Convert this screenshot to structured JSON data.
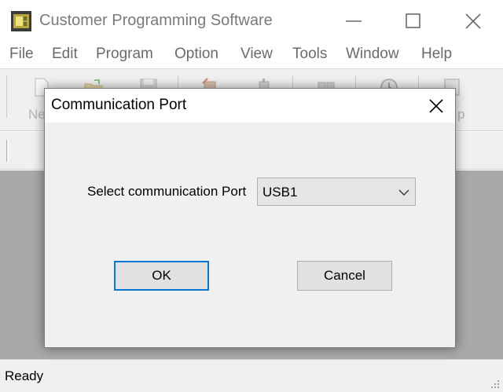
{
  "window": {
    "title": "Customer Programming Software",
    "icon": "app-chip-icon"
  },
  "menu": {
    "items": [
      {
        "label": "File"
      },
      {
        "label": "Edit"
      },
      {
        "label": "Program"
      },
      {
        "label": "Option"
      },
      {
        "label": "View"
      },
      {
        "label": "Tools"
      },
      {
        "label": "Window"
      },
      {
        "label": "Help"
      }
    ]
  },
  "toolbar": {
    "visible_label_fragments": {
      "first": "Ne",
      "last": "p"
    },
    "icons": [
      "new-file-icon",
      "open-folder-icon",
      "save-icon",
      "read-radio-icon",
      "write-radio-icon",
      "clone-icon",
      "clock-icon",
      "help-icon"
    ]
  },
  "dialog": {
    "title": "Communication Port",
    "port_label": "Select communication Port",
    "port_value": "USB1",
    "ok_label": "OK",
    "cancel_label": "Cancel"
  },
  "status": {
    "text": "Ready"
  },
  "colors": {
    "focus_border": "#0078d7",
    "workspace": "#a9a9a9",
    "chrome": "#f0f0f0"
  }
}
